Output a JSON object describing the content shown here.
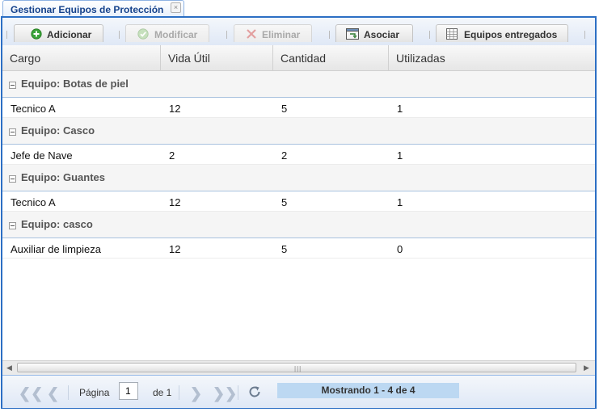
{
  "tab": {
    "title": "Gestionar Equipos de Protección",
    "close_glyph": "×"
  },
  "toolbar": {
    "buttons": [
      {
        "label": "Adicionar",
        "icon": "add-icon",
        "enabled": true
      },
      {
        "label": "Modificar",
        "icon": "edit-icon",
        "enabled": false
      },
      {
        "label": "Eliminar",
        "icon": "delete-icon",
        "enabled": false
      },
      {
        "label": "Asociar",
        "icon": "associate-icon",
        "enabled": true
      },
      {
        "label": "Equipos entregados",
        "icon": "table-icon",
        "enabled": true
      }
    ]
  },
  "grid": {
    "columns": [
      "Cargo",
      "Vida Útil",
      "Cantidad",
      "Utilizadas"
    ],
    "groups": [
      {
        "label": "Equipo: Botas de piel",
        "rows": [
          {
            "cargo": "Tecnico A",
            "vida_util": "12",
            "cantidad": "5",
            "utilizadas": "1"
          }
        ]
      },
      {
        "label": "Equipo: Casco",
        "rows": [
          {
            "cargo": "Jefe de Nave",
            "vida_util": "2",
            "cantidad": "2",
            "utilizadas": "1"
          }
        ]
      },
      {
        "label": "Equipo: Guantes",
        "rows": [
          {
            "cargo": "Tecnico A",
            "vida_util": "12",
            "cantidad": "5",
            "utilizadas": "1"
          }
        ]
      },
      {
        "label": "Equipo: casco",
        "rows": [
          {
            "cargo": "Auxiliar de limpieza",
            "vida_util": "12",
            "cantidad": "5",
            "utilizadas": "0"
          }
        ]
      }
    ]
  },
  "paging": {
    "page_label": "Página",
    "page_value": "1",
    "of_label": "de 1",
    "status": "Mostrando 1 - 4 de 4",
    "first_glyph": "❮❮",
    "prev_glyph": "❮",
    "next_glyph": "❯",
    "last_glyph": "❯❯"
  },
  "colors": {
    "frame": "#2c6fc4",
    "tab_title": "#15428b",
    "status_bg": "#bcd8f2",
    "add_green": "#3aa33a"
  }
}
